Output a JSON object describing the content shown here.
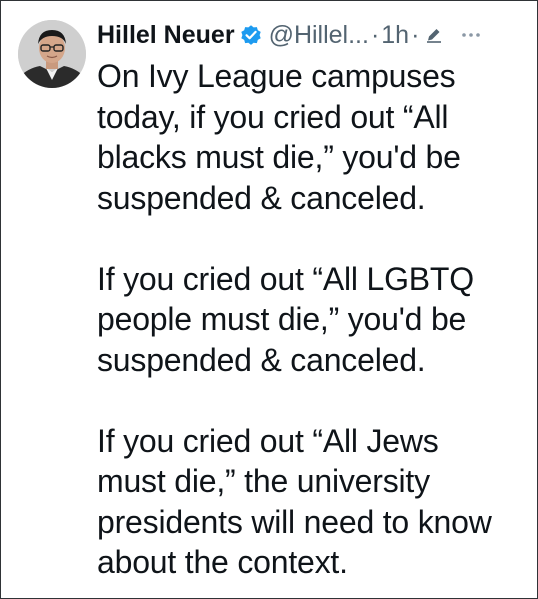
{
  "author": {
    "display_name": "Hillel Neuer",
    "handle": "@Hillel...",
    "verified": true
  },
  "meta": {
    "separator": "·",
    "time": "1h",
    "edited_icon": "pencil-icon",
    "more_icon": "ellipsis-icon"
  },
  "tweet": {
    "paragraphs": [
      "On Ivy League campuses\ntoday, if you cried out “All\nblacks must die,” you'd be\nsuspended & canceled.",
      "If you cried out “All LGBTQ\npeople must die,” you'd be\nsuspended & canceled.",
      "If you cried out “All Jews\nmust die,” the university\npresidents will need to know\nabout the context."
    ]
  },
  "colors": {
    "text_primary": "#0f1419",
    "text_secondary": "#536471",
    "verified_blue": "#1d9bf0",
    "frame_border": "#2f3336"
  }
}
